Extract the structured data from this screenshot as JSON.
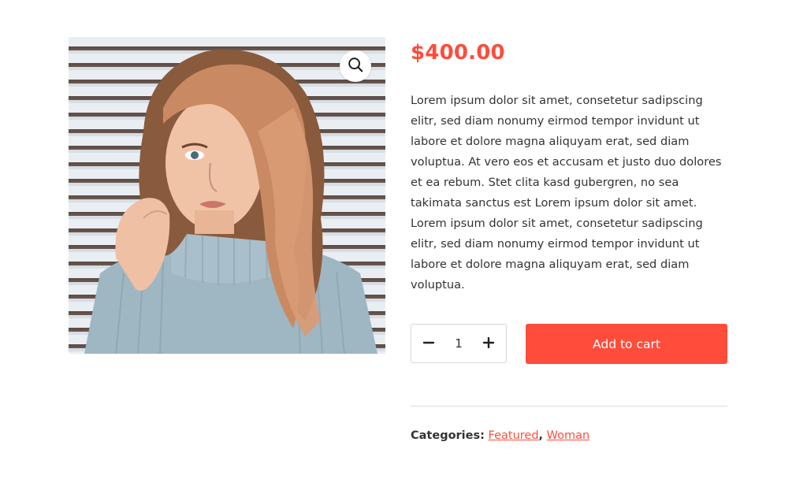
{
  "product": {
    "image_alt": "Woman in light blue turtleneck sweater",
    "zoom_icon": "search-icon",
    "price": "$400.00",
    "description": "Lorem ipsum dolor sit amet, consetetur sadipscing elitr, sed diam nonumy eirmod tempor invidunt ut labore et dolore magna aliquyam erat, sed diam voluptua. At vero eos et accusam et justo duo dolores et ea rebum. Stet clita kasd gubergren, no sea takimata sanctus est Lorem ipsum dolor sit amet. Lorem ipsum dolor sit amet, consetetur sadipscing elitr, sed diam nonumy eirmod tempor invidunt ut labore et dolore magna aliquyam erat, sed diam voluptua.",
    "quantity": "1",
    "minus_icon": "minus-icon",
    "plus_icon": "plus-icon",
    "add_to_cart_label": "Add to cart"
  },
  "categories": {
    "label": "Categories:",
    "items": [
      {
        "label": "Featured"
      },
      {
        "label": "Woman"
      }
    ],
    "separator": ","
  },
  "colors": {
    "accent": "#ff4c3b",
    "text": "#333333",
    "border": "#d6d6d6"
  }
}
